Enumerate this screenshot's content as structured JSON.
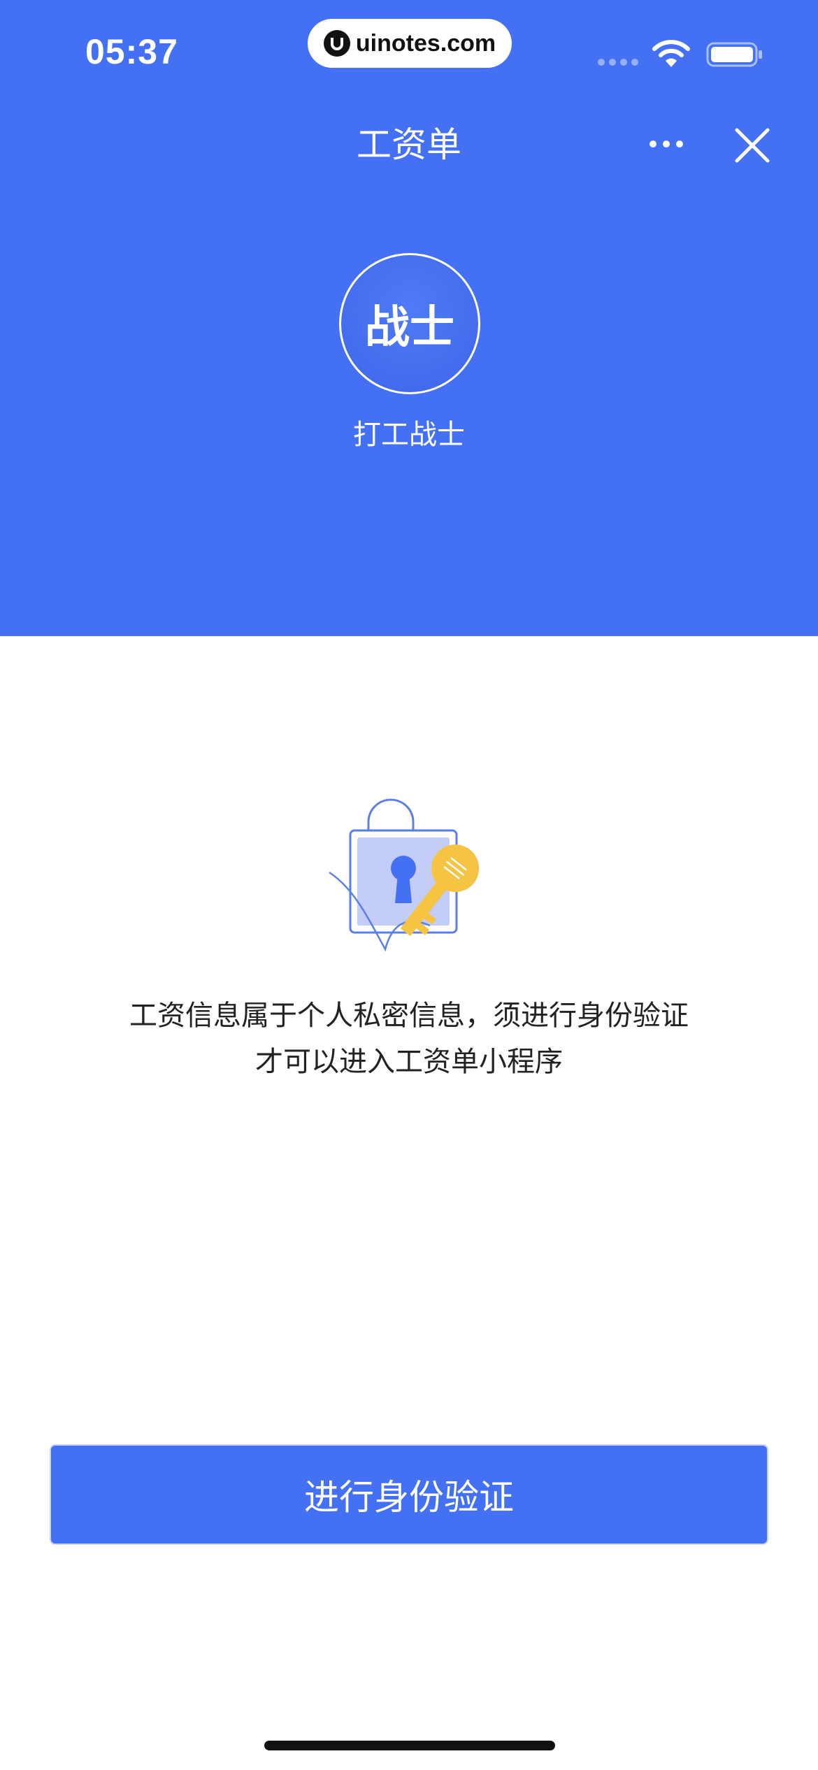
{
  "status_bar": {
    "time": "05:37",
    "watermark": "uinotes.com"
  },
  "nav": {
    "title": "工资单"
  },
  "profile": {
    "avatar_text": "战士",
    "name": "打工战士"
  },
  "content": {
    "message_line1": "工资信息属于个人私密信息，须进行身份验证",
    "message_line2": "才可以进入工资单小程序"
  },
  "actions": {
    "verify_label": "进行身份验证"
  },
  "colors": {
    "primary": "#4470F3",
    "key_yellow": "#F6C443"
  }
}
